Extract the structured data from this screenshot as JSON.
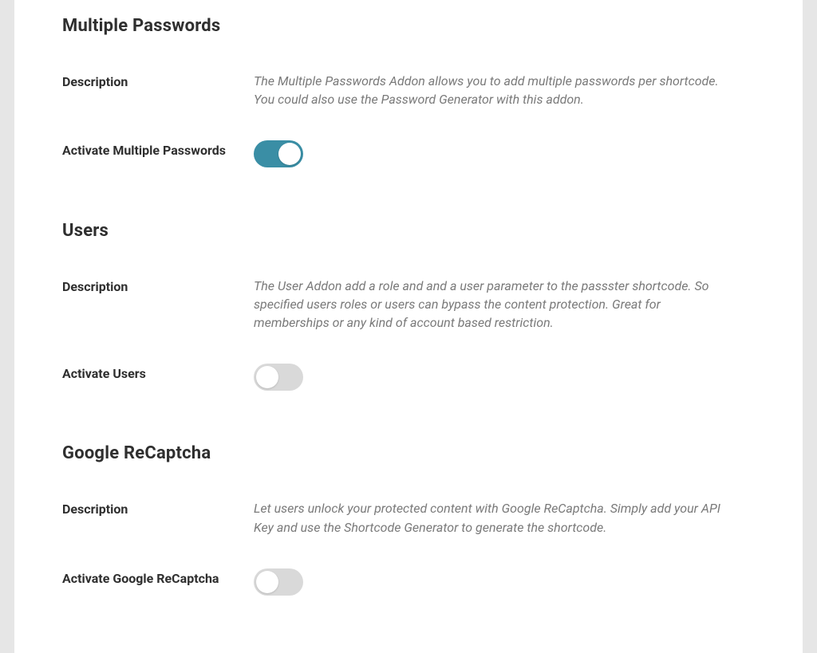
{
  "sections": {
    "multiplePasswords": {
      "heading": "Multiple Passwords",
      "descriptionLabel": "Description",
      "descriptionText": "The Multiple Passwords Addon allows you to add multiple passwords per shortcode. You could also use the Password Generator with this addon.",
      "activateLabel": "Activate Multiple Passwords",
      "activateState": true
    },
    "users": {
      "heading": "Users",
      "descriptionLabel": "Description",
      "descriptionText": "The User Addon add a role and and a user parameter to the passster shortcode. So specified users roles or users can bypass the content protection. Great for memberships or any kind of account based restriction.",
      "activateLabel": "Activate Users",
      "activateState": false
    },
    "googleRecaptcha": {
      "heading": "Google ReCaptcha",
      "descriptionLabel": "Description",
      "descriptionText": "Let users unlock your protected content with Google ReCaptcha. Simply add your API Key and use the Shortcode Generator to generate the shortcode.",
      "activateLabel": "Activate Google ReCaptcha",
      "activateState": false
    }
  }
}
